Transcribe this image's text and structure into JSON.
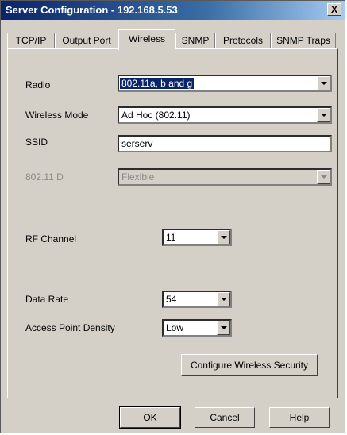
{
  "window": {
    "title": "Server Configuration - 192.168.5.53",
    "close_glyph": "X"
  },
  "tabs": [
    {
      "label": "TCP/IP"
    },
    {
      "label": "Output Port"
    },
    {
      "label": "Wireless",
      "active": true
    },
    {
      "label": "SNMP"
    },
    {
      "label": "Protocols"
    },
    {
      "label": "SNMP Traps"
    }
  ],
  "wireless": {
    "radio": {
      "label": "Radio",
      "value": "802.11a, b and g"
    },
    "mode": {
      "label": "Wireless Mode",
      "value": "Ad Hoc (802.11)"
    },
    "ssid": {
      "label": "SSID",
      "value": "serserv"
    },
    "d80211": {
      "label": "802.11 D",
      "value": "Flexible"
    },
    "rf_channel": {
      "label": "RF Channel",
      "value": "11"
    },
    "data_rate": {
      "label": "Data Rate",
      "value": "54"
    },
    "ap_density": {
      "label": "Access Point Density",
      "value": "Low"
    },
    "security_button": "Configure Wireless Security"
  },
  "footer": {
    "ok": "OK",
    "cancel": "Cancel",
    "help": "Help"
  },
  "colors": {
    "title_start": "#0a246a",
    "title_end": "#a6caf0",
    "selection": "#0a246a",
    "face": "#d4d0c8"
  }
}
